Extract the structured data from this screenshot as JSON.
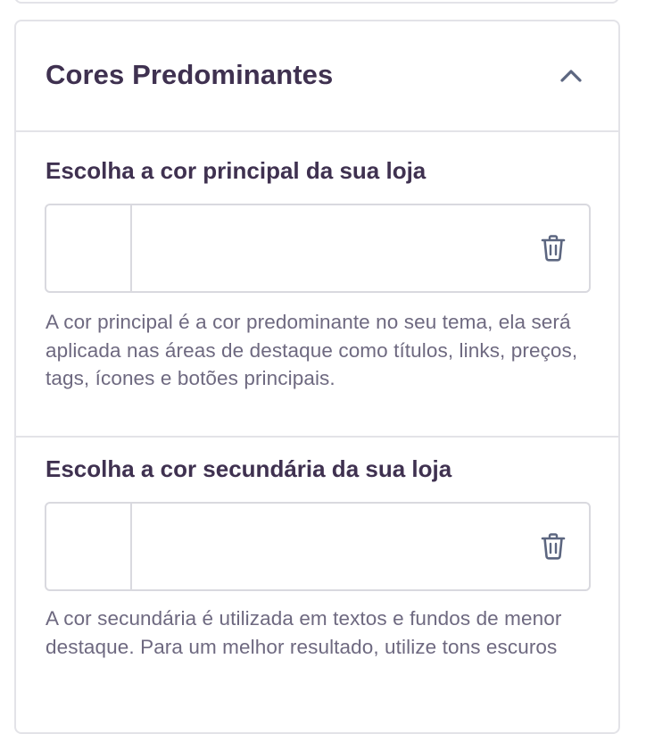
{
  "panel": {
    "title": "Cores Predominantes",
    "collapse_icon": "chevron-up-icon"
  },
  "primary_color": {
    "label": "Escolha a cor principal da sua loja",
    "value": "",
    "delete_icon": "trash-icon",
    "help": "A cor principal é a cor predominante no seu tema, ela será aplicada nas áreas de destaque como títulos, links, preços, tags, ícones e botões principais."
  },
  "secondary_color": {
    "label": "Escolha a cor secundária da sua loja",
    "value": "",
    "delete_icon": "trash-icon",
    "help": "A cor secundária é utilizada em textos e fundos de menor destaque. Para um melhor resultado, utilize tons escuros"
  },
  "colors": {
    "title_text": "#3f3150",
    "help_text": "#6e6980",
    "border": "#e3e3e8",
    "icon": "#5c6680"
  }
}
